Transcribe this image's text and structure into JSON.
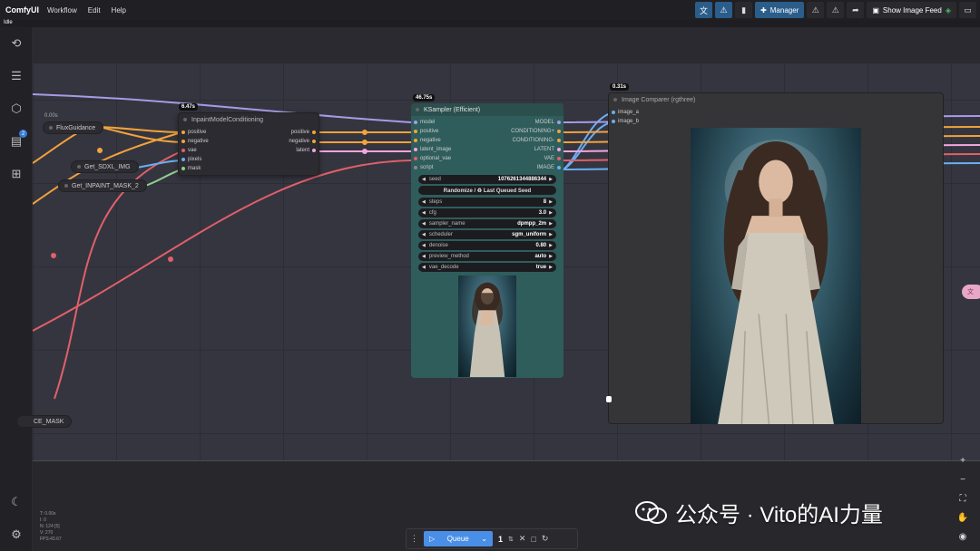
{
  "app": {
    "brand": "ComfyUI",
    "status": "Idle"
  },
  "menu": [
    "Workflow",
    "Edit",
    "Help"
  ],
  "toolbar": {
    "manager_label": "Manager",
    "feed_label": "Show Image Feed"
  },
  "sidebar": {
    "queue_badge": "2"
  },
  "nodes": {
    "flux_guidance": {
      "title": "FluxGuidance",
      "value": "0.00s"
    },
    "inpaint": {
      "title": "InpaintModelConditioning",
      "time": "6.47s",
      "inputs": [
        "positive",
        "negative",
        "vae",
        "pixels",
        "mask"
      ],
      "outputs": [
        "positive",
        "negative",
        "latent"
      ]
    },
    "get_sdxl": {
      "title": "Get_SDXL_IMG"
    },
    "get_mask": {
      "title": "Get_INPAINT_MASK_2"
    },
    "mask_partial": {
      "title": "CE_MASK"
    },
    "ksampler": {
      "title": "KSampler (Efficient)",
      "time": "46.75s",
      "inputs": [
        "model",
        "positive",
        "negative",
        "latent_image",
        "optional_vae",
        "script"
      ],
      "outputs": [
        "MODEL",
        "CONDITIONING+",
        "CONDITIONING-",
        "LATENT",
        "VAE",
        "IMAGE"
      ],
      "widgets": [
        {
          "key": "seed",
          "value": "1076261344886344"
        },
        {
          "key": "steps",
          "value": "8"
        },
        {
          "key": "cfg",
          "value": "3.0"
        },
        {
          "key": "sampler_name",
          "value": "dpmpp_2m"
        },
        {
          "key": "scheduler",
          "value": "sgm_uniform"
        },
        {
          "key": "denoise",
          "value": "0.80"
        },
        {
          "key": "preview_method",
          "value": "auto"
        },
        {
          "key": "vae_decode",
          "value": "true"
        }
      ],
      "seed_button": "Randomize / ♻ Last Queued Seed"
    },
    "comparer": {
      "title": "Image Comparer (rgthree)",
      "time": "0.31s",
      "inputs": [
        "image_a",
        "image_b"
      ]
    }
  },
  "queue": {
    "label": "Queue",
    "count": "1"
  },
  "stats": [
    "T: 0.00s",
    "I: 0",
    "N: 124 [5]",
    "V: 270",
    "FPS:43.67"
  ],
  "watermark": "公众号 · Vito的AI力量",
  "colors": {
    "accent": "#4a8fe7",
    "ksampler_bg": "#2f5d5b",
    "link_purple": "#a99ae6",
    "link_orange": "#f2a33a",
    "link_red": "#e0606a",
    "link_blue": "#6aaef2"
  }
}
